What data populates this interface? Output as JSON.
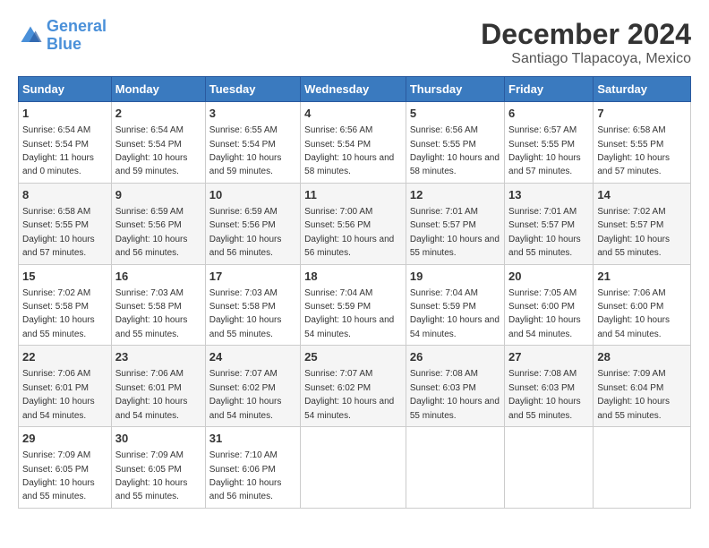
{
  "logo": {
    "line1": "General",
    "line2": "Blue"
  },
  "title": "December 2024",
  "subtitle": "Santiago Tlapacoya, Mexico",
  "weekdays": [
    "Sunday",
    "Monday",
    "Tuesday",
    "Wednesday",
    "Thursday",
    "Friday",
    "Saturday"
  ],
  "weeks": [
    [
      {
        "day": "1",
        "sunrise": "6:54 AM",
        "sunset": "5:54 PM",
        "daylight": "11 hours and 0 minutes."
      },
      {
        "day": "2",
        "sunrise": "6:54 AM",
        "sunset": "5:54 PM",
        "daylight": "10 hours and 59 minutes."
      },
      {
        "day": "3",
        "sunrise": "6:55 AM",
        "sunset": "5:54 PM",
        "daylight": "10 hours and 59 minutes."
      },
      {
        "day": "4",
        "sunrise": "6:56 AM",
        "sunset": "5:54 PM",
        "daylight": "10 hours and 58 minutes."
      },
      {
        "day": "5",
        "sunrise": "6:56 AM",
        "sunset": "5:55 PM",
        "daylight": "10 hours and 58 minutes."
      },
      {
        "day": "6",
        "sunrise": "6:57 AM",
        "sunset": "5:55 PM",
        "daylight": "10 hours and 57 minutes."
      },
      {
        "day": "7",
        "sunrise": "6:58 AM",
        "sunset": "5:55 PM",
        "daylight": "10 hours and 57 minutes."
      }
    ],
    [
      {
        "day": "8",
        "sunrise": "6:58 AM",
        "sunset": "5:55 PM",
        "daylight": "10 hours and 57 minutes."
      },
      {
        "day": "9",
        "sunrise": "6:59 AM",
        "sunset": "5:56 PM",
        "daylight": "10 hours and 56 minutes."
      },
      {
        "day": "10",
        "sunrise": "6:59 AM",
        "sunset": "5:56 PM",
        "daylight": "10 hours and 56 minutes."
      },
      {
        "day": "11",
        "sunrise": "7:00 AM",
        "sunset": "5:56 PM",
        "daylight": "10 hours and 56 minutes."
      },
      {
        "day": "12",
        "sunrise": "7:01 AM",
        "sunset": "5:57 PM",
        "daylight": "10 hours and 55 minutes."
      },
      {
        "day": "13",
        "sunrise": "7:01 AM",
        "sunset": "5:57 PM",
        "daylight": "10 hours and 55 minutes."
      },
      {
        "day": "14",
        "sunrise": "7:02 AM",
        "sunset": "5:57 PM",
        "daylight": "10 hours and 55 minutes."
      }
    ],
    [
      {
        "day": "15",
        "sunrise": "7:02 AM",
        "sunset": "5:58 PM",
        "daylight": "10 hours and 55 minutes."
      },
      {
        "day": "16",
        "sunrise": "7:03 AM",
        "sunset": "5:58 PM",
        "daylight": "10 hours and 55 minutes."
      },
      {
        "day": "17",
        "sunrise": "7:03 AM",
        "sunset": "5:58 PM",
        "daylight": "10 hours and 55 minutes."
      },
      {
        "day": "18",
        "sunrise": "7:04 AM",
        "sunset": "5:59 PM",
        "daylight": "10 hours and 54 minutes."
      },
      {
        "day": "19",
        "sunrise": "7:04 AM",
        "sunset": "5:59 PM",
        "daylight": "10 hours and 54 minutes."
      },
      {
        "day": "20",
        "sunrise": "7:05 AM",
        "sunset": "6:00 PM",
        "daylight": "10 hours and 54 minutes."
      },
      {
        "day": "21",
        "sunrise": "7:06 AM",
        "sunset": "6:00 PM",
        "daylight": "10 hours and 54 minutes."
      }
    ],
    [
      {
        "day": "22",
        "sunrise": "7:06 AM",
        "sunset": "6:01 PM",
        "daylight": "10 hours and 54 minutes."
      },
      {
        "day": "23",
        "sunrise": "7:06 AM",
        "sunset": "6:01 PM",
        "daylight": "10 hours and 54 minutes."
      },
      {
        "day": "24",
        "sunrise": "7:07 AM",
        "sunset": "6:02 PM",
        "daylight": "10 hours and 54 minutes."
      },
      {
        "day": "25",
        "sunrise": "7:07 AM",
        "sunset": "6:02 PM",
        "daylight": "10 hours and 54 minutes."
      },
      {
        "day": "26",
        "sunrise": "7:08 AM",
        "sunset": "6:03 PM",
        "daylight": "10 hours and 55 minutes."
      },
      {
        "day": "27",
        "sunrise": "7:08 AM",
        "sunset": "6:03 PM",
        "daylight": "10 hours and 55 minutes."
      },
      {
        "day": "28",
        "sunrise": "7:09 AM",
        "sunset": "6:04 PM",
        "daylight": "10 hours and 55 minutes."
      }
    ],
    [
      {
        "day": "29",
        "sunrise": "7:09 AM",
        "sunset": "6:05 PM",
        "daylight": "10 hours and 55 minutes."
      },
      {
        "day": "30",
        "sunrise": "7:09 AM",
        "sunset": "6:05 PM",
        "daylight": "10 hours and 55 minutes."
      },
      {
        "day": "31",
        "sunrise": "7:10 AM",
        "sunset": "6:06 PM",
        "daylight": "10 hours and 56 minutes."
      },
      null,
      null,
      null,
      null
    ]
  ]
}
